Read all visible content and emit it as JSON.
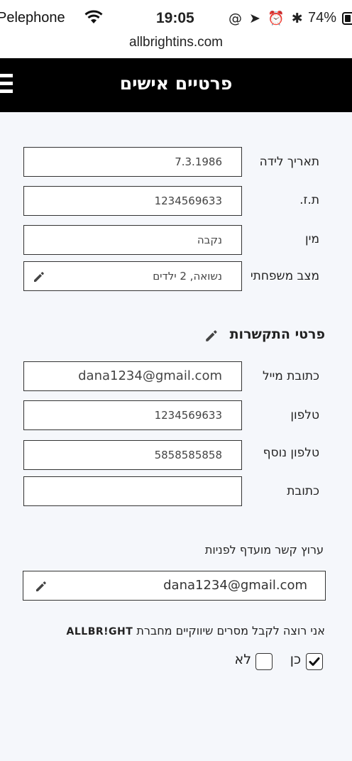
{
  "status_bar": {
    "carrier": "Pelephone",
    "time": "19:05",
    "status_icons": "@ ➤ ⏰ ✱",
    "battery": "74%",
    "battery_level": 0.74
  },
  "browser": {
    "url": "allbrightins.com"
  },
  "header": {
    "title": "פרטיים אישים",
    "menu_icon": "hamburger-icon"
  },
  "personal": [
    {
      "label": "תאריך לידה",
      "value": "7.3.1986",
      "editable": false
    },
    {
      "label": "ת.ז.",
      "value": "1234569633",
      "editable": false
    },
    {
      "label": "מין",
      "value": "נקבה",
      "editable": false
    },
    {
      "label": "מצב משפחתי",
      "value": "נשואה, 2 ילדים",
      "editable": true
    }
  ],
  "contact": {
    "title": "פרטי התקשרות",
    "fields": [
      {
        "label": "כתובת מייל",
        "value": "dana1234@gmail.com"
      },
      {
        "label": "טלפון",
        "value": "1234569633"
      },
      {
        "label": "טלפון נוסף",
        "value": "5858585858"
      },
      {
        "label": "כתובת",
        "value": ""
      }
    ]
  },
  "preferred_channel": {
    "label": "ערוץ קשר מועדף לפניות",
    "value": "dana1234@gmail.com"
  },
  "marketing": {
    "text": "אני רוצה לקבל מסרים שיווקיים מחברת",
    "brand": "ALLBR!GHT",
    "yes_label": "כן",
    "no_label": "לא",
    "yes_checked": true,
    "no_checked": false
  }
}
